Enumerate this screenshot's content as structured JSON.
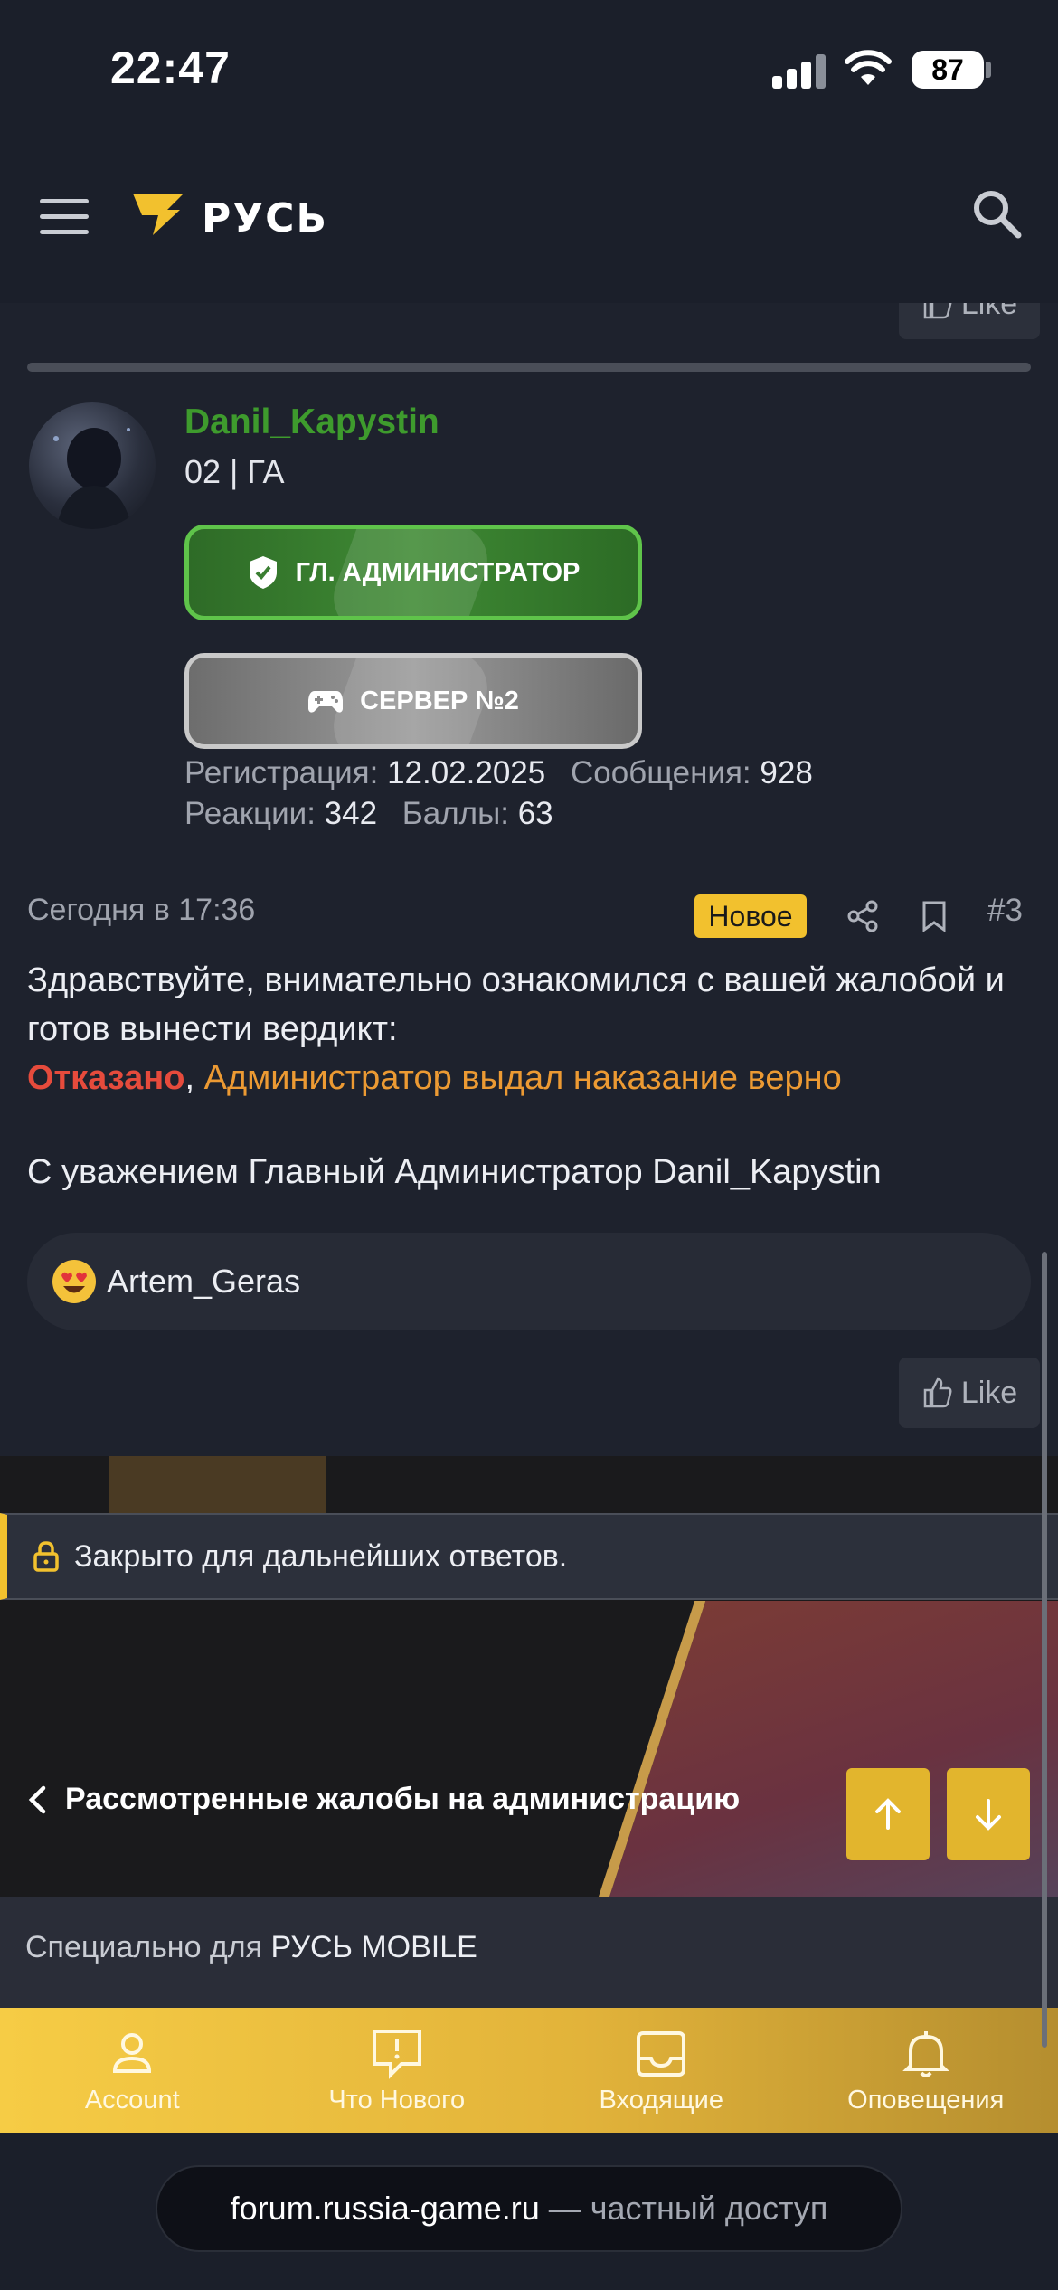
{
  "status_bar": {
    "time": "22:47",
    "battery": "87"
  },
  "header": {
    "logo_text": "РУСЬ"
  },
  "like_label": "Like",
  "post": {
    "author": "Danil_Kapystin",
    "user_title": "02 | ГА",
    "badges": {
      "admin": "ГЛ. АДМИНИСТРАТОР",
      "server": "СЕРВЕР №2"
    },
    "stats": {
      "registration_label": "Регистрация:",
      "registration_value": "12.02.2025",
      "messages_label": "Сообщения:",
      "messages_value": "928",
      "reactions_label": "Реакции:",
      "reactions_value": "342",
      "points_label": "Баллы:",
      "points_value": "63"
    },
    "date": "Сегодня в 17:36",
    "new_label": "Новое",
    "number": "#3",
    "body_line1": "Здравствуйте, внимательно ознакомился с вашей жалобой и готов вынести вердикт:",
    "verdict_red": "Отказано",
    "verdict_comma": ",",
    "verdict_orange": "Администратор выдал наказание верно",
    "signature": "С уважением Главный Администратор Danil_Kapystin",
    "reaction_user": "Artem_Geras"
  },
  "closed_notice": "Закрыто для дальнейших ответов.",
  "breadcrumb": "Рассмотренные жалобы на администрацию",
  "special": {
    "prefix": "Специально для",
    "brand": "РУСЬ MOBILE"
  },
  "tabbar": [
    {
      "label": "Account",
      "icon": "person-icon"
    },
    {
      "label": "Что Нового",
      "icon": "whats-new-icon"
    },
    {
      "label": "Входящие",
      "icon": "inbox-icon"
    },
    {
      "label": "Оповещения",
      "icon": "bell-icon"
    }
  ],
  "url_bar": {
    "domain": "forum.russia-game.ru",
    "suffix": "— частный доступ"
  },
  "colors": {
    "accent": "#f2c12e",
    "username": "#3e9b2d",
    "refused": "#e64b3c",
    "verdict": "#ec9a33"
  }
}
